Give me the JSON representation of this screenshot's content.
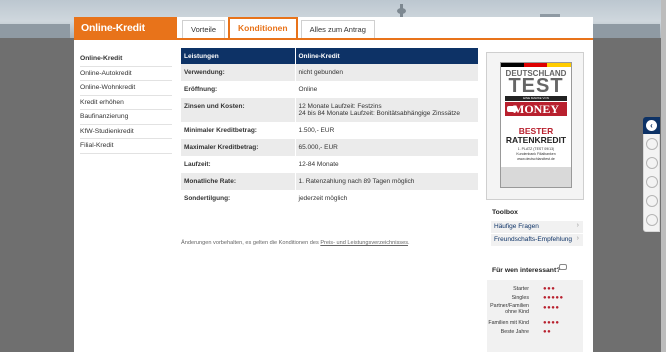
{
  "brand": "Online-Kredit",
  "tabs": [
    {
      "label": "Vorteile",
      "active": false
    },
    {
      "label": "Konditionen",
      "active": true
    },
    {
      "label": "Alles zum Antrag",
      "active": false
    }
  ],
  "sidebar": {
    "items": [
      {
        "label": "Online-Kredit",
        "active": true
      },
      {
        "label": "Online-Autokredit"
      },
      {
        "label": "Online-Wohnkredit"
      },
      {
        "label": "Kredit erhöhen"
      },
      {
        "label": "Baufinanzierung"
      },
      {
        "label": "KfW-Studienkredit"
      },
      {
        "label": "Filial-Kredit"
      }
    ]
  },
  "table": {
    "headers": [
      "Leistungen",
      "Online-Kredit"
    ],
    "rows": [
      {
        "label": "Verwendung:",
        "value": "nicht gebunden"
      },
      {
        "label": "Eröffnung:",
        "value": "Online"
      },
      {
        "label": "Zinsen und Kosten:",
        "value": "12 Monate Laufzeit: Festzins",
        "value2": "24 bis 84 Monate Laufzeit: Bonitätsabhängige Zinssätze"
      },
      {
        "label": "Minimaler Kreditbetrag:",
        "value": "1.500,- EUR"
      },
      {
        "label": "Maximaler Kreditbetrag:",
        "value": "65.000,- EUR"
      },
      {
        "label": "Laufzeit:",
        "value": "12-84 Monate"
      },
      {
        "label": "Monatliche Rate:",
        "value": "1. Ratenzahlung nach 89 Tagen möglich"
      },
      {
        "label": "Sondertilgung:",
        "value": "jederzeit möglich"
      }
    ]
  },
  "footnote": {
    "text": "Änderungen vorbehalten, es gelten die Konditionen des ",
    "link": "Preis- und Leistungsverzeichnisses",
    "end": "."
  },
  "seal": {
    "line1": "DEUTSCHLAND",
    "line2": "TEST",
    "line3": "EINE MARKE VON",
    "magazine": "MONEY",
    "award1": "BESTER",
    "award2": "RATENKREDIT",
    "detail1": "1. PLATZ (TEST 09/13)",
    "detail2": "Kundenbank Filialbanken",
    "detail3": "www.deutschlandtest.de"
  },
  "toolbox": {
    "title": "Toolbox",
    "items": [
      "Häufige Fragen",
      "Freundschafts-Empfehlung"
    ]
  },
  "who": {
    "title": "Für wen interessant?",
    "rows": [
      {
        "label": "Starter",
        "dots": "●●●"
      },
      {
        "label": "Singles",
        "dots": "●●●●●"
      },
      {
        "label": "Partner/Familien ohne Kind",
        "dots": "●●●●"
      },
      {
        "label": "Familien mit Kind",
        "dots": "●●●●"
      },
      {
        "label": "Beste Jahre",
        "dots": "●●"
      }
    ]
  },
  "colors": {
    "accent": "#e8731a",
    "navy": "#0d3266",
    "dot_red": "#b8202e"
  },
  "right_panel_icons": [
    "chevron-left-icon",
    "phone-icon",
    "chat-icon",
    "people-icon",
    "at-icon",
    "pdf-icon"
  ]
}
